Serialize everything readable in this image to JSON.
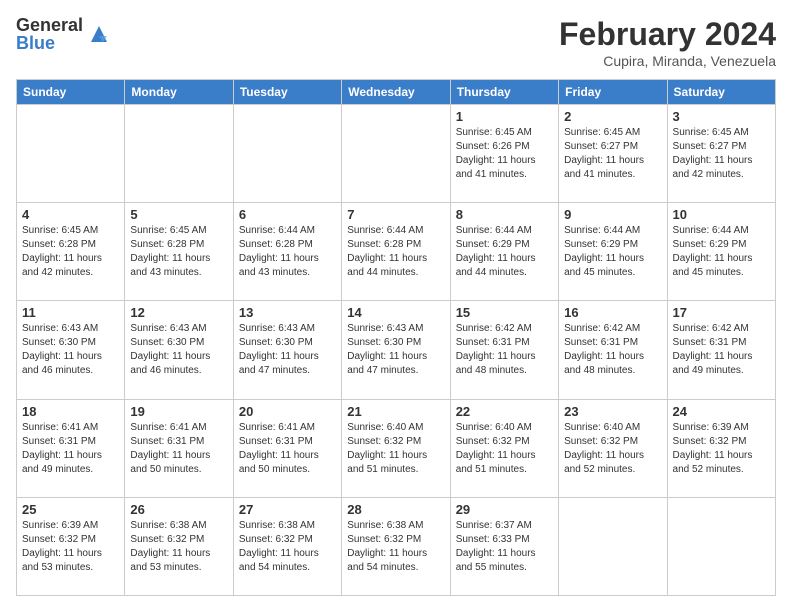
{
  "logo": {
    "general": "General",
    "blue": "Blue"
  },
  "title": "February 2024",
  "subtitle": "Cupira, Miranda, Venezuela",
  "headers": [
    "Sunday",
    "Monday",
    "Tuesday",
    "Wednesday",
    "Thursday",
    "Friday",
    "Saturday"
  ],
  "weeks": [
    [
      {
        "day": "",
        "info": ""
      },
      {
        "day": "",
        "info": ""
      },
      {
        "day": "",
        "info": ""
      },
      {
        "day": "",
        "info": ""
      },
      {
        "day": "1",
        "info": "Sunrise: 6:45 AM\nSunset: 6:26 PM\nDaylight: 11 hours and 41 minutes."
      },
      {
        "day": "2",
        "info": "Sunrise: 6:45 AM\nSunset: 6:27 PM\nDaylight: 11 hours and 41 minutes."
      },
      {
        "day": "3",
        "info": "Sunrise: 6:45 AM\nSunset: 6:27 PM\nDaylight: 11 hours and 42 minutes."
      }
    ],
    [
      {
        "day": "4",
        "info": "Sunrise: 6:45 AM\nSunset: 6:28 PM\nDaylight: 11 hours and 42 minutes."
      },
      {
        "day": "5",
        "info": "Sunrise: 6:45 AM\nSunset: 6:28 PM\nDaylight: 11 hours and 43 minutes."
      },
      {
        "day": "6",
        "info": "Sunrise: 6:44 AM\nSunset: 6:28 PM\nDaylight: 11 hours and 43 minutes."
      },
      {
        "day": "7",
        "info": "Sunrise: 6:44 AM\nSunset: 6:28 PM\nDaylight: 11 hours and 44 minutes."
      },
      {
        "day": "8",
        "info": "Sunrise: 6:44 AM\nSunset: 6:29 PM\nDaylight: 11 hours and 44 minutes."
      },
      {
        "day": "9",
        "info": "Sunrise: 6:44 AM\nSunset: 6:29 PM\nDaylight: 11 hours and 45 minutes."
      },
      {
        "day": "10",
        "info": "Sunrise: 6:44 AM\nSunset: 6:29 PM\nDaylight: 11 hours and 45 minutes."
      }
    ],
    [
      {
        "day": "11",
        "info": "Sunrise: 6:43 AM\nSunset: 6:30 PM\nDaylight: 11 hours and 46 minutes."
      },
      {
        "day": "12",
        "info": "Sunrise: 6:43 AM\nSunset: 6:30 PM\nDaylight: 11 hours and 46 minutes."
      },
      {
        "day": "13",
        "info": "Sunrise: 6:43 AM\nSunset: 6:30 PM\nDaylight: 11 hours and 47 minutes."
      },
      {
        "day": "14",
        "info": "Sunrise: 6:43 AM\nSunset: 6:30 PM\nDaylight: 11 hours and 47 minutes."
      },
      {
        "day": "15",
        "info": "Sunrise: 6:42 AM\nSunset: 6:31 PM\nDaylight: 11 hours and 48 minutes."
      },
      {
        "day": "16",
        "info": "Sunrise: 6:42 AM\nSunset: 6:31 PM\nDaylight: 11 hours and 48 minutes."
      },
      {
        "day": "17",
        "info": "Sunrise: 6:42 AM\nSunset: 6:31 PM\nDaylight: 11 hours and 49 minutes."
      }
    ],
    [
      {
        "day": "18",
        "info": "Sunrise: 6:41 AM\nSunset: 6:31 PM\nDaylight: 11 hours and 49 minutes."
      },
      {
        "day": "19",
        "info": "Sunrise: 6:41 AM\nSunset: 6:31 PM\nDaylight: 11 hours and 50 minutes."
      },
      {
        "day": "20",
        "info": "Sunrise: 6:41 AM\nSunset: 6:31 PM\nDaylight: 11 hours and 50 minutes."
      },
      {
        "day": "21",
        "info": "Sunrise: 6:40 AM\nSunset: 6:32 PM\nDaylight: 11 hours and 51 minutes."
      },
      {
        "day": "22",
        "info": "Sunrise: 6:40 AM\nSunset: 6:32 PM\nDaylight: 11 hours and 51 minutes."
      },
      {
        "day": "23",
        "info": "Sunrise: 6:40 AM\nSunset: 6:32 PM\nDaylight: 11 hours and 52 minutes."
      },
      {
        "day": "24",
        "info": "Sunrise: 6:39 AM\nSunset: 6:32 PM\nDaylight: 11 hours and 52 minutes."
      }
    ],
    [
      {
        "day": "25",
        "info": "Sunrise: 6:39 AM\nSunset: 6:32 PM\nDaylight: 11 hours and 53 minutes."
      },
      {
        "day": "26",
        "info": "Sunrise: 6:38 AM\nSunset: 6:32 PM\nDaylight: 11 hours and 53 minutes."
      },
      {
        "day": "27",
        "info": "Sunrise: 6:38 AM\nSunset: 6:32 PM\nDaylight: 11 hours and 54 minutes."
      },
      {
        "day": "28",
        "info": "Sunrise: 6:38 AM\nSunset: 6:32 PM\nDaylight: 11 hours and 54 minutes."
      },
      {
        "day": "29",
        "info": "Sunrise: 6:37 AM\nSunset: 6:33 PM\nDaylight: 11 hours and 55 minutes."
      },
      {
        "day": "",
        "info": ""
      },
      {
        "day": "",
        "info": ""
      }
    ]
  ]
}
